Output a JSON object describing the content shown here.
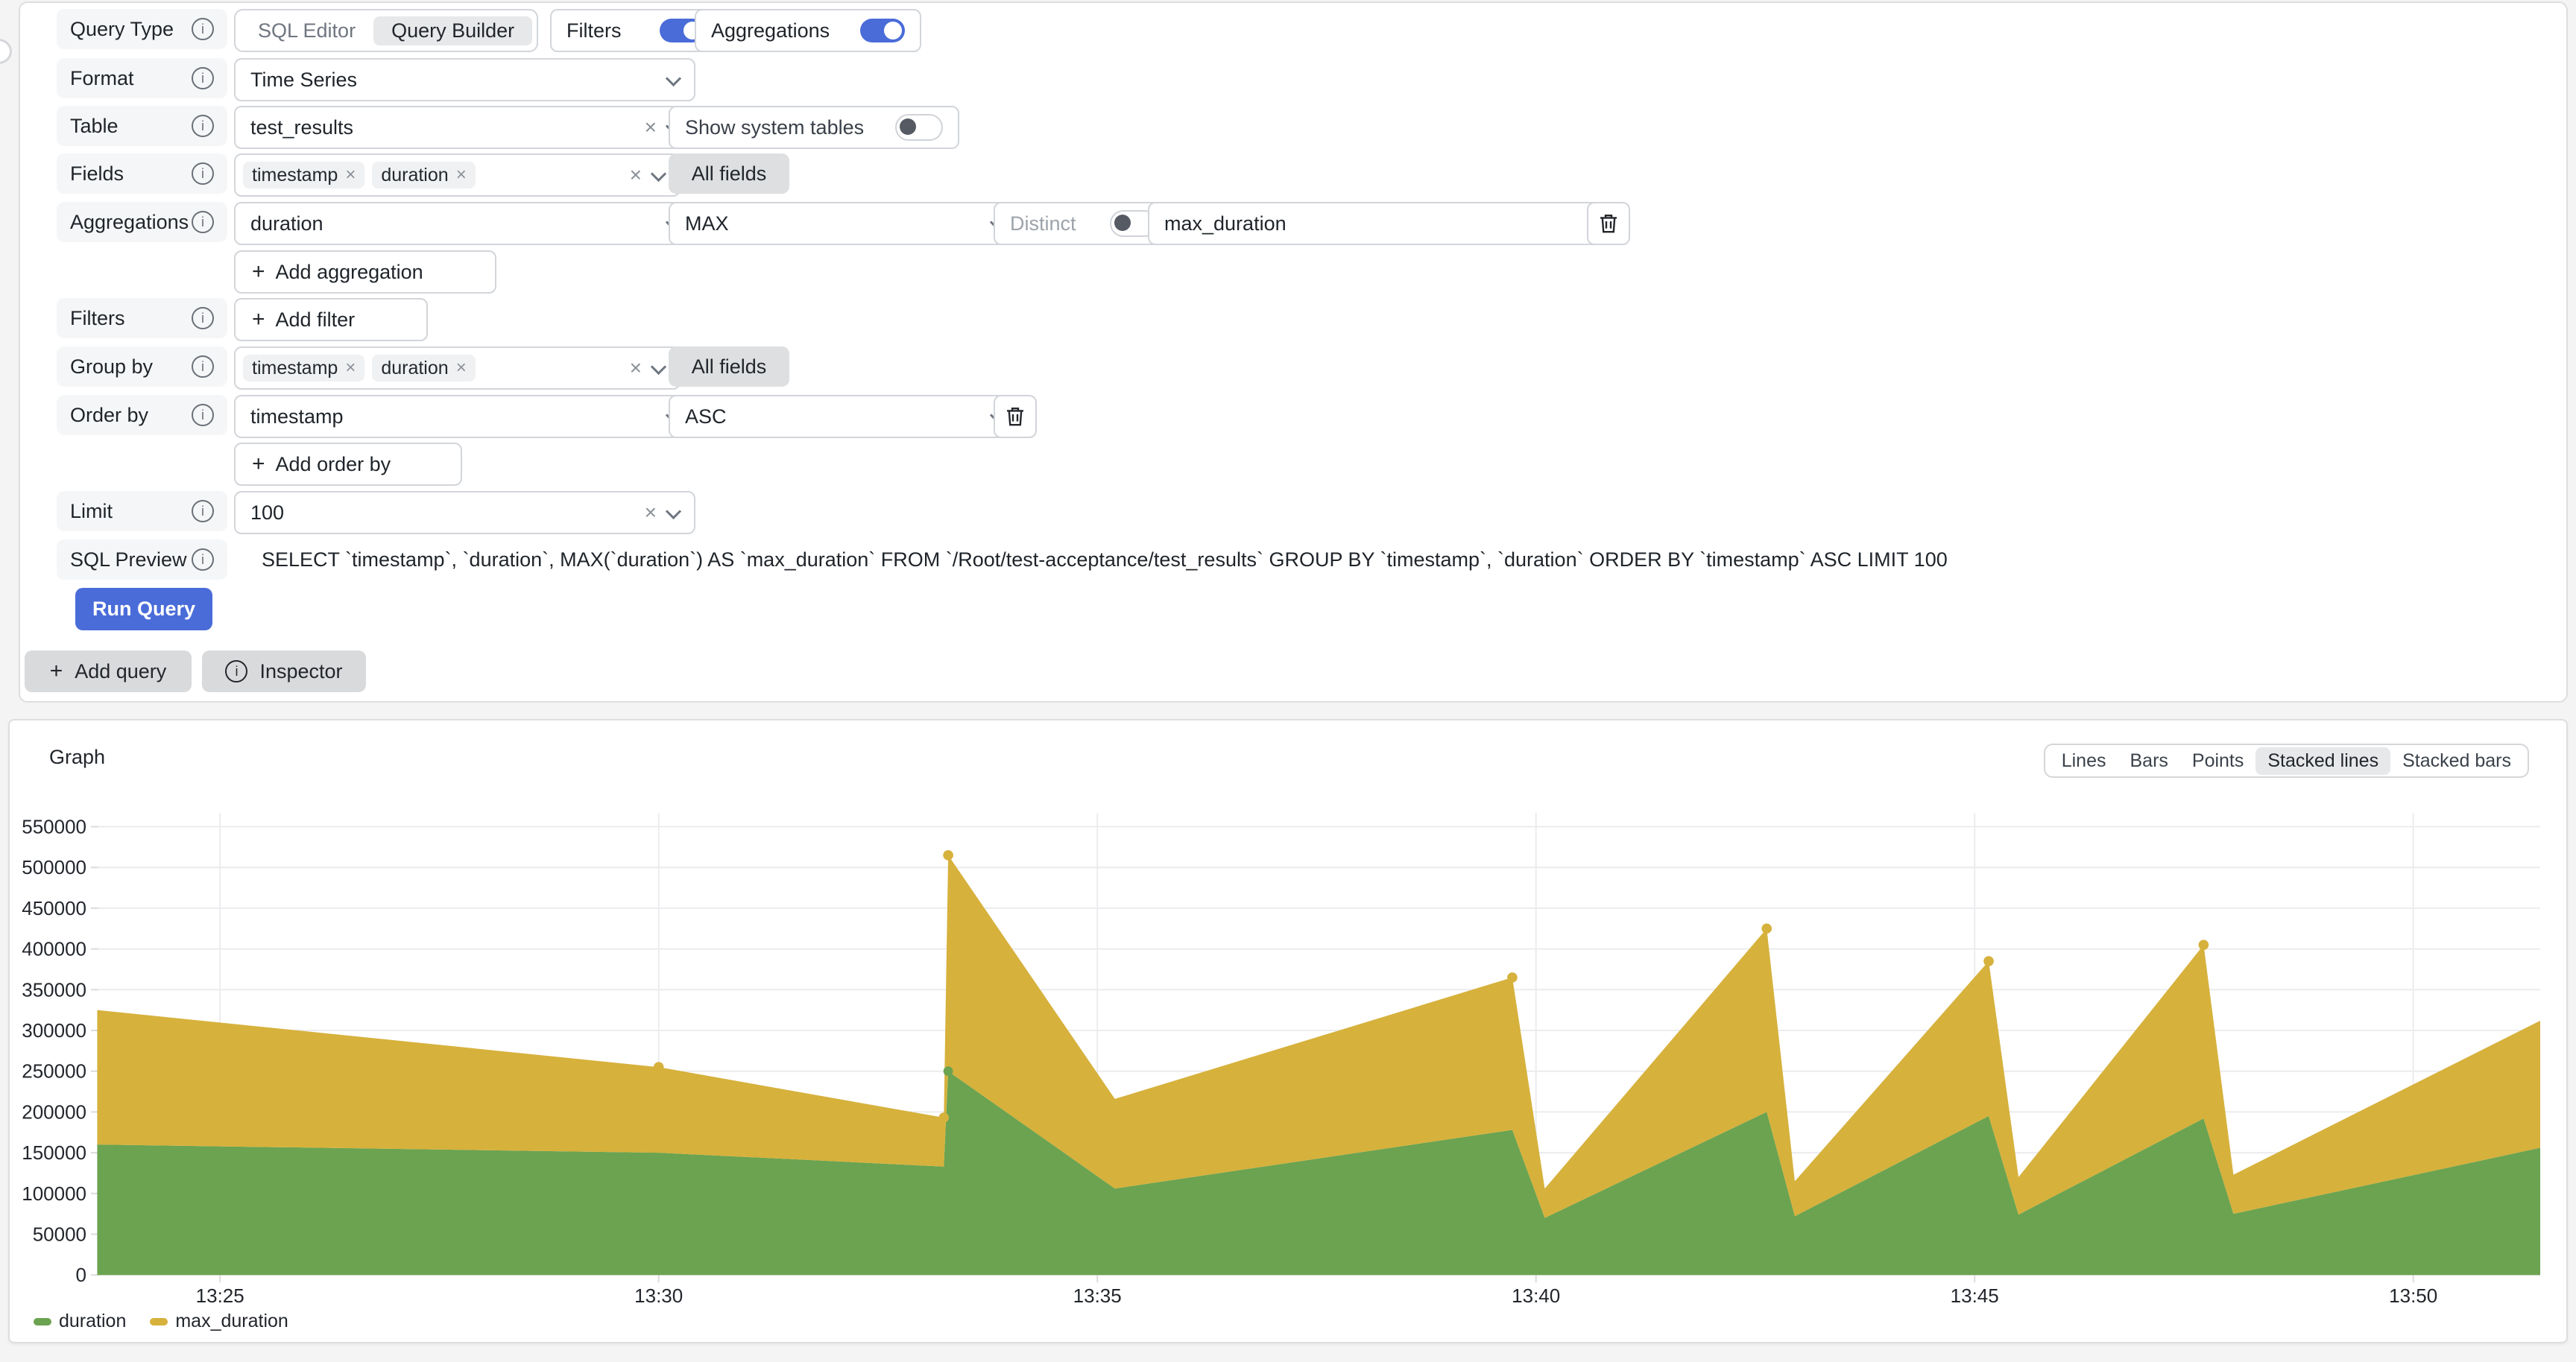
{
  "query_editor": {
    "query_type": {
      "label": "Query Type",
      "options": [
        "SQL Editor",
        "Query Builder"
      ],
      "selected": "Query Builder"
    },
    "filters_switch": {
      "label": "Filters",
      "on": true
    },
    "aggregations_switch": {
      "label": "Aggregations",
      "on": true
    },
    "format": {
      "label": "Format",
      "value": "Time Series"
    },
    "table": {
      "label": "Table",
      "value": "test_results"
    },
    "show_system_tables": {
      "label": "Show system tables",
      "on": false
    },
    "fields": {
      "label": "Fields",
      "tags": [
        "timestamp",
        "duration"
      ],
      "all_fields": "All fields"
    },
    "aggregations": {
      "label": "Aggregations",
      "column": "duration",
      "function": "MAX",
      "distinct_label": "Distinct",
      "distinct_on": false,
      "alias": "max_duration",
      "add_button": "Add aggregation"
    },
    "filters": {
      "label": "Filters",
      "add_button": "Add filter"
    },
    "group_by": {
      "label": "Group by",
      "tags": [
        "timestamp",
        "duration"
      ],
      "all_fields": "All fields"
    },
    "order_by": {
      "label": "Order by",
      "column": "timestamp",
      "direction": "ASC",
      "add_button": "Add order by"
    },
    "limit": {
      "label": "Limit",
      "value": "100"
    },
    "sql_preview": {
      "label": "SQL Preview",
      "sql": "SELECT `timestamp`, `duration`, MAX(`duration`) AS `max_duration` FROM `/Root/test-acceptance/test_results` GROUP BY `timestamp`, `duration` ORDER BY `timestamp` ASC LIMIT 100"
    },
    "run_button": "Run Query",
    "add_query_button": "Add query",
    "inspector_button": "Inspector"
  },
  "graph": {
    "title": "Graph",
    "modes": [
      "Lines",
      "Bars",
      "Points",
      "Stacked lines",
      "Stacked bars"
    ],
    "selected_mode": "Stacked lines"
  },
  "chart_data": {
    "type": "area",
    "stacked": true,
    "title": "Graph",
    "legend_position": "bottom-left",
    "grid": true,
    "series_names": [
      "duration",
      "max_duration"
    ],
    "colors": {
      "duration": "#6ba350",
      "max_duration": "#d6b13c",
      "grid": "#ebecee",
      "tick": "#d9dbdd",
      "axis_text": "#22262c"
    },
    "y_axis": {
      "min": 0,
      "max": 550000,
      "step": 50000
    },
    "x_axis": {
      "base_time": "13:20",
      "tick_minutes": [
        5,
        10,
        15,
        20,
        25,
        30
      ],
      "tick_labels": [
        "13:25",
        "13:30",
        "13:35",
        "13:40",
        "13:45",
        "13:50"
      ],
      "range_minutes": [
        3.6,
        31.5
      ]
    },
    "points_format": "[minutes_after_13:20, duration, max_duration, marker_flag]",
    "points": [
      [
        3.6,
        160000,
        165000,
        0
      ],
      [
        10.0,
        150000,
        105000,
        1
      ],
      [
        13.25,
        133000,
        60000,
        1
      ],
      [
        13.3,
        250000,
        265000,
        2
      ],
      [
        15.2,
        106000,
        110000,
        0
      ],
      [
        19.73,
        178000,
        187000,
        1
      ],
      [
        20.1,
        70000,
        36000,
        0
      ],
      [
        22.63,
        200000,
        225000,
        1
      ],
      [
        22.95,
        72000,
        43000,
        0
      ],
      [
        25.16,
        195000,
        190000,
        1
      ],
      [
        25.5,
        74000,
        46000,
        0
      ],
      [
        27.61,
        192000,
        213000,
        1
      ],
      [
        27.95,
        75000,
        48000,
        0
      ],
      [
        31.5,
        156000,
        156000,
        0
      ]
    ]
  }
}
